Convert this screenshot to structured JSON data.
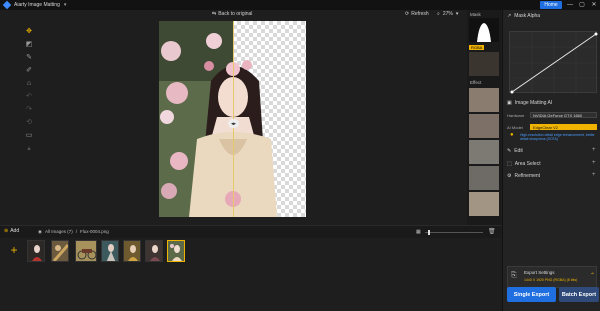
{
  "app": {
    "title": "Aiarty Image Matting"
  },
  "titlebar": {
    "home_label": "Home",
    "minimize": "—",
    "maximize": "▢",
    "close": "✕"
  },
  "toolbar": {
    "back_label": "Back to original",
    "refresh_label": "Refresh",
    "zoom_value": "27%"
  },
  "strip": {
    "mask_label": "Mask",
    "rgba_label": "RGBA",
    "effect_label": "Effect"
  },
  "panel": {
    "mask_alpha": "Mask Alpha",
    "image_matting_ai": "Image Matting AI",
    "hardware_label": "Hardware",
    "hardware_value": "NVIDIA GeForce GTX 1660",
    "ai_model_label": "AI Model",
    "ai_model_value": "EdgeClear V2",
    "tip": "High-resolution detail edge enhancement, better detail sharpness (SOTA)",
    "edit_label": "Edit",
    "area_select_label": "Area Select",
    "refinement_label": "Refinement",
    "export_settings_label": "Export Settings",
    "export_settings_value": "1440 X 1920  PNG (RGBA) (8 bits)",
    "single_export": "Single Export",
    "batch_export": "Batch Export"
  },
  "filmbar": {
    "add_label": "Add",
    "all_images": "All Images (7)",
    "separator": "/",
    "file_name": "Flux-0004.png",
    "zoom_fraction": 0.05
  },
  "colors": {
    "accent": "#f0b400",
    "primary": "#1f6fe0",
    "panel": "#232323",
    "background": "#1e1e1e"
  }
}
